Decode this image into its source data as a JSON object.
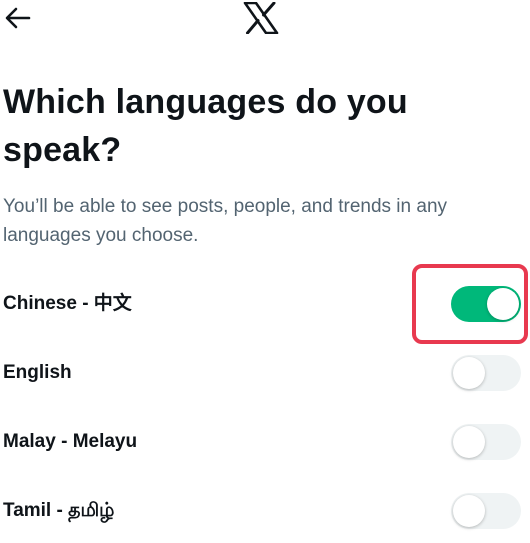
{
  "header": {
    "back_icon": "arrow-left-icon",
    "logo_icon": "x-logo-icon"
  },
  "main": {
    "title": "Which languages do you speak?",
    "subtitle": "You’ll be able to see posts, people, and trends in any languages you choose."
  },
  "languages": [
    {
      "label": "Chinese - 中文",
      "enabled": true
    },
    {
      "label": "English",
      "enabled": false
    },
    {
      "label": "Malay - Melayu",
      "enabled": false
    },
    {
      "label": "Tamil - தமிழ்",
      "enabled": false
    }
  ],
  "colors": {
    "toggle_on": "#00b87a",
    "toggle_off": "#eff3f4",
    "highlight": "#e8394f",
    "text_primary": "#0f1419",
    "text_secondary": "#536471"
  }
}
